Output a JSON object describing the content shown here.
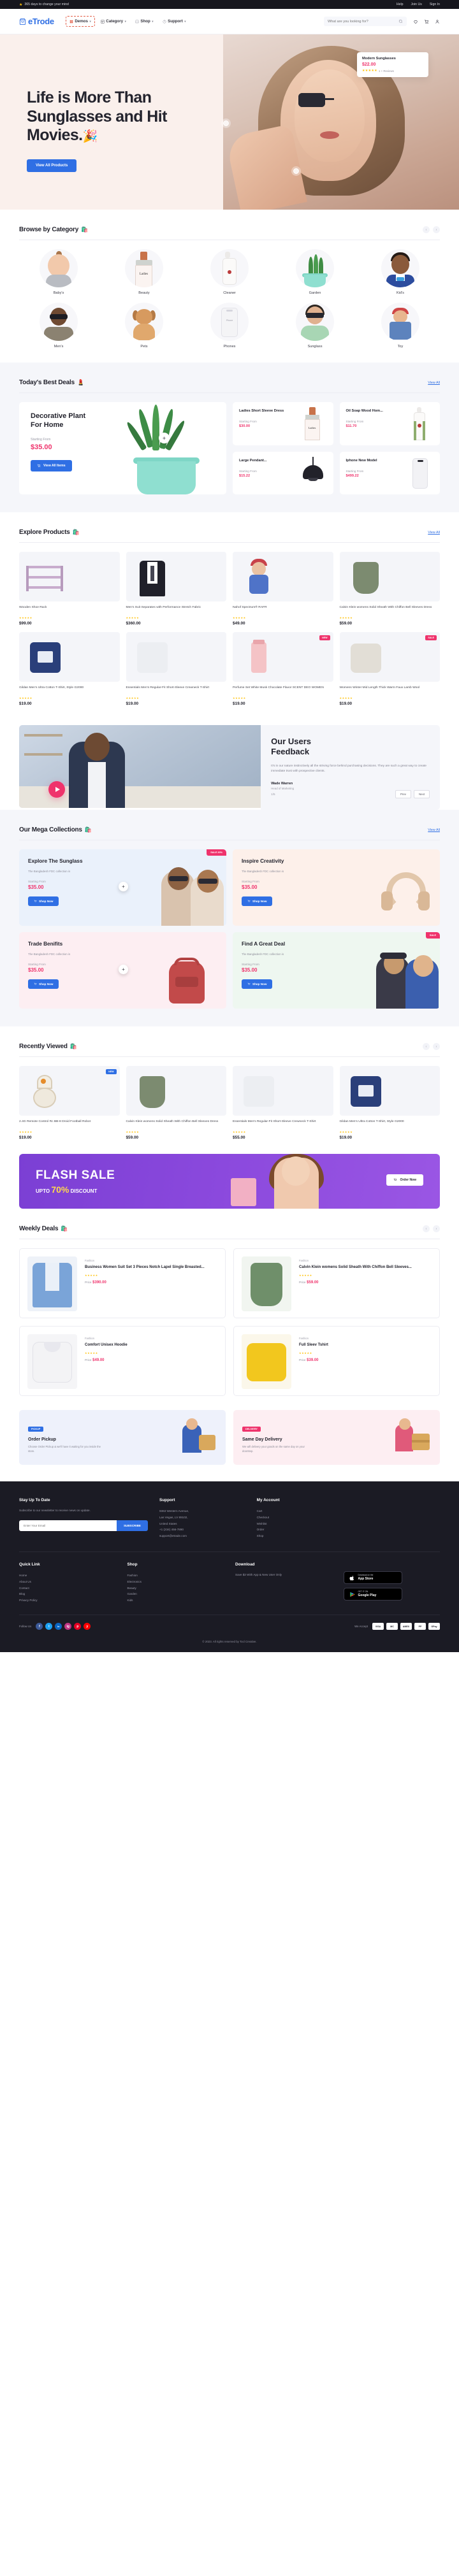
{
  "topbar": {
    "promo": "365 days to change your mind",
    "links": [
      "Help",
      "Join Us",
      "Sign In"
    ]
  },
  "header": {
    "brand": "eTrode",
    "nav": [
      {
        "label": "Demos",
        "icon": "grid-icon",
        "active": true
      },
      {
        "label": "Category",
        "icon": "category-icon",
        "active": false
      },
      {
        "label": "Shop",
        "icon": "bag-icon",
        "active": false
      },
      {
        "label": "Support",
        "icon": "support-icon",
        "active": false
      }
    ],
    "search_placeholder": "What are you looking for?",
    "icons": [
      "wishlist-icon",
      "cart-icon",
      "account-icon"
    ]
  },
  "hero": {
    "title_line1": "Life is More Than",
    "title_line2": "Sunglasses and Hit",
    "title_line3": "Movies.",
    "emoji": "🎉",
    "cta": "View All Products",
    "card": {
      "name": "Modern Sunglasses",
      "price": "$22.00",
      "stars": "★★★★★",
      "reviews": "1 + Reviews"
    }
  },
  "category": {
    "title": "Browse by Category",
    "emoji": "🛍️",
    "items": [
      {
        "label": "Baby's",
        "icon": "baby"
      },
      {
        "label": "Beauty",
        "icon": "beauty"
      },
      {
        "label": "Cleaner",
        "icon": "cleaner"
      },
      {
        "label": "Garden",
        "icon": "garden"
      },
      {
        "label": "Kid's",
        "icon": "kid"
      },
      {
        "label": "Men's",
        "icon": "mens"
      },
      {
        "label": "Pets",
        "icon": "pets"
      },
      {
        "label": "Phones",
        "icon": "phone"
      },
      {
        "label": "Sunglass",
        "icon": "sunglass"
      },
      {
        "label": "Toy",
        "icon": "toy"
      }
    ]
  },
  "deals": {
    "title": "Today's Best Deals",
    "emoji": "💄",
    "view_all": "View All",
    "featured": {
      "name_line1": "Decorative Plant",
      "name_line2": "For Home",
      "starting_label": "Starting From",
      "price": "$35.00",
      "button": "View All Items"
    },
    "items": [
      {
        "name": "Ladies Short Sleeve Dress",
        "starting_label": "Starting From",
        "price": "$30.00",
        "icon": "bottle"
      },
      {
        "name": "Oil Soap Wood Hom...",
        "starting_label": "Starting From",
        "price": "$11.70",
        "icon": "soap"
      },
      {
        "name": "Large Pendant...",
        "starting_label": "Starting From",
        "price": "$15.22",
        "icon": "lamp"
      },
      {
        "name": "Iphone New Model",
        "starting_label": "Starting From",
        "price": "$499.22",
        "icon": "phone"
      }
    ]
  },
  "explore": {
    "title": "Explore Products",
    "emoji": "🛍️",
    "view_all": "View All",
    "products": [
      {
        "name": "Wooden Shoe Rack",
        "price": "$99.00",
        "stars": "★★★★★",
        "badge": "",
        "icon": "shoe-rack"
      },
      {
        "name": "Men's Suit Separates with Performance Stretch Fabric",
        "price": "$360.00",
        "stars": "★★★★★",
        "badge": "",
        "icon": "suit"
      },
      {
        "name": "Nahof Spectrum® RAFR",
        "price": "$49.00",
        "stars": "★★★★★",
        "badge": "",
        "icon": "doll"
      },
      {
        "name": "Calvin Klein womens Solid Sheath With Chiffon Bell Sleeves Dress",
        "price": "$59.00",
        "stars": "★★★★★",
        "badge": "",
        "icon": "dress"
      },
      {
        "name": "Gildan Men's Ultra Cotton T-Shirt, Style G2000",
        "price": "$19.00",
        "stars": "★★★★★",
        "badge": "",
        "icon": "tshirt-blue"
      },
      {
        "name": "Essentials Men's Regular-Fit Short-Sleeve Crewneck T-Shirt",
        "price": "$19.00",
        "stars": "★★★★★",
        "badge": "",
        "icon": "tshirt-grey"
      },
      {
        "name": "Perfume Set White Musk Chocolate Flavor SCENT DEO WOMEN",
        "price": "$19.00",
        "stars": "★★★★★",
        "badge": "NEW",
        "icon": "cream"
      },
      {
        "name": "Womens Winter Mid Length Thick Warm Faux Lamb Wool",
        "price": "$19.00",
        "stars": "★★★★★",
        "badge": "SALE",
        "icon": "cardigan"
      }
    ]
  },
  "feedback": {
    "title_line1": "Our Users",
    "title_line2": "Feedback",
    "body": "It's in our nature instinctively all the striving force behind purchasing decisions. They are such a great way to create immediate trust with prospective clients.",
    "name": "Wade Warren",
    "role": "Head of Marketing",
    "counter": "1/5",
    "prev": "Prev",
    "next": "Next"
  },
  "mega": {
    "title": "Our Mega Collections",
    "emoji": "🛍️",
    "view_all": "View All",
    "cards": [
      {
        "heading": "Explore The Sunglass",
        "desc": "The Bangladesh FDC collection is",
        "starting_label": "Starting From",
        "price": "$35.00",
        "button": "Shop Now",
        "badge": "SALE 20%",
        "bg": "#eaf1fb"
      },
      {
        "heading": "Inspire Creativity",
        "desc": "The Bangladesh FDC collection is",
        "starting_label": "Starting From",
        "price": "$35.00",
        "button": "Shop Now",
        "badge": "",
        "bg": "#fdf0ea"
      },
      {
        "heading": "Trade Benifits",
        "desc": "The Bangladesh FDC collection is",
        "starting_label": "Starting From",
        "price": "$35.00",
        "button": "Shop Now",
        "badge": "",
        "bg": "#fdeef2"
      },
      {
        "heading": "Find A Great Deal",
        "desc": "The Bangladesh FDC collection is",
        "starting_label": "Starting From",
        "price": "$35.00",
        "button": "Shop Now",
        "badge": "SALE",
        "bg": "#eef7f0"
      }
    ]
  },
  "recent": {
    "title": "Recently Viewed",
    "emoji": "🛍️",
    "products": [
      {
        "name": "2.4G Remote Control Rc BB-8 Droid Football Robot",
        "price": "$19.00",
        "stars": "★★★★★",
        "badge": "NEW",
        "icon": "robot"
      },
      {
        "name": "Calvin Klein womens Solid Sheath With Chiffon Bell Sleeves Dress",
        "price": "$59.00",
        "stars": "★★★★★",
        "badge": "",
        "icon": "dress"
      },
      {
        "name": "Essentials Men's Regular-Fit Short-Sleeve Crewneck T-Shirt",
        "price": "$55.00",
        "stars": "★★★★★",
        "badge": "",
        "icon": "tshirt-grey"
      },
      {
        "name": "Gildan Men's Ultra Cotton T-Shirt, Style G2000",
        "price": "$19.00",
        "stars": "★★★★★",
        "badge": "",
        "icon": "tshirt-blue"
      }
    ]
  },
  "flash": {
    "title": "FLASH SALE",
    "upto": "UPTO",
    "percent": "70%",
    "discount": "DISCOUNT",
    "button": "Order Now"
  },
  "weekly": {
    "title": "Weekly Deals",
    "emoji": "🛍️",
    "items": [
      {
        "cat": "Fashion",
        "name": "Business Women Suit Set 3 Pieces Notch Lapel Single Breasted...",
        "price": "$390.00",
        "price_label": "Price",
        "stars": "★★★★★",
        "icon": "blazer"
      },
      {
        "cat": "Fashion",
        "name": "Calvin Klein womens Solid Sheath With Chiffon Bell Sleeves...",
        "price": "$59.00",
        "price_label": "Price",
        "stars": "★★★★★",
        "icon": "green-dress"
      },
      {
        "cat": "Fashion",
        "name": "Comfort Unisex Hoodie",
        "price": "$49.00",
        "price_label": "Price",
        "stars": "★★★★★",
        "icon": "hoodie"
      },
      {
        "cat": "Fashion",
        "name": "Full Sleev Tshirt",
        "price": "$39.00",
        "price_label": "Price",
        "stars": "★★★★★",
        "icon": "yellow-shirt"
      }
    ]
  },
  "promos": [
    {
      "tag": "PICKUP",
      "heading": "Order Pickup",
      "desc": "Choose Order Pickup & we'll have it waiting for you inside the store.",
      "icon": "pickup"
    },
    {
      "tag": "DELIVERY",
      "heading": "Same Day Delivery",
      "desc": "We will delivery your goods on the same day on your doorstep.",
      "icon": "delivery"
    }
  ],
  "footer": {
    "signup": {
      "title": "Stay Up To Date",
      "body": "Subscribe to our newsletter to receive news on update.",
      "placeholder": "Enter Your Email",
      "button": "SUBSCRIBE"
    },
    "columns": [
      {
        "title": "Support",
        "items": [
          "9363 Western Avenue,",
          "Las Vegas, LV 89102,",
          "United States",
          "",
          "+1 (234) 456-7890",
          "support@etrade.com"
        ]
      },
      {
        "title": "My Account",
        "items": [
          "Cart",
          "Checkout",
          "Wishlist",
          "Order",
          "Shop"
        ]
      }
    ],
    "quick_links": {
      "title": "Quick Link",
      "items": [
        "Home",
        "About Us",
        "Contact",
        "Blog",
        "Privacy Policy"
      ]
    },
    "shop_links": {
      "title": "Shop",
      "items": [
        "Fashion",
        "Electronics",
        "Beauty",
        "Garden",
        "Kids"
      ]
    },
    "download": {
      "title": "Download",
      "note": "Save $3 With App & New User Only",
      "apple": {
        "small": "Download on the",
        "big": "App Store"
      },
      "google": {
        "small": "GET IT ON",
        "big": "Google Play"
      }
    },
    "follow_label": "Follow Us",
    "socials": [
      "f",
      "t",
      "in",
      "ig",
      "p",
      "y"
    ],
    "pay_label": "We Accept",
    "payments": [
      "VISA",
      "MC",
      "AMEX",
      "PP",
      "GPay"
    ],
    "copyright": "© 2023. All rights reserved by Tocl Creative."
  }
}
